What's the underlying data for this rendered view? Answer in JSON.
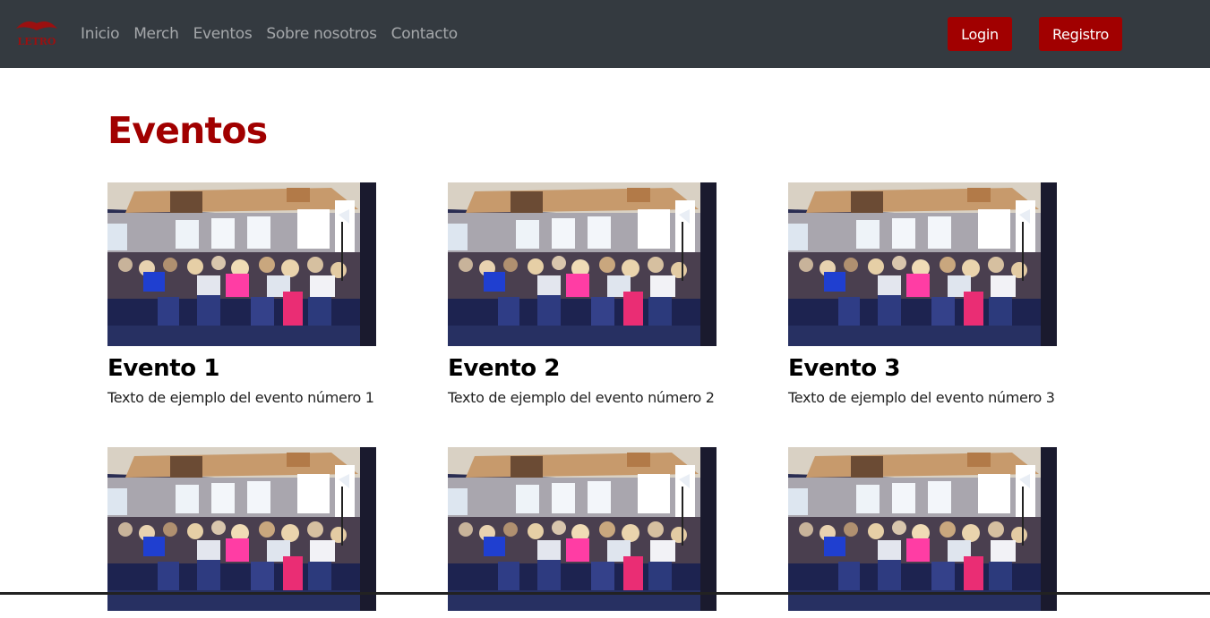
{
  "nav": {
    "logo_text": "LETRO",
    "links": [
      "Inicio",
      "Merch",
      "Eventos",
      "Sobre nosotros",
      "Contacto"
    ],
    "login_label": "Login",
    "register_label": "Registro"
  },
  "page": {
    "title": "Eventos"
  },
  "events": [
    {
      "title": "Evento 1",
      "text": "Texto de ejemplo del evento número 1"
    },
    {
      "title": "Evento 2",
      "text": "Texto de ejemplo del evento número 2"
    },
    {
      "title": "Evento 3",
      "text": "Texto de ejemplo del evento número 3"
    },
    {
      "title": "",
      "text": ""
    },
    {
      "title": "",
      "text": ""
    },
    {
      "title": "",
      "text": ""
    }
  ],
  "colors": {
    "navbar": "#343a40",
    "accent": "#a10000"
  }
}
